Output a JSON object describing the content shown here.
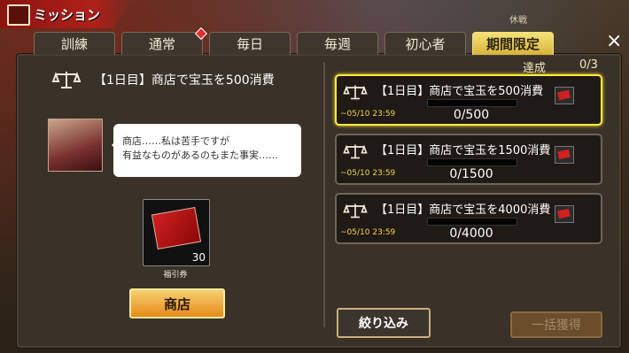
{
  "header": {
    "title": "ミッション",
    "status": "休戦"
  },
  "tabs": [
    {
      "label": "訓練",
      "active": false,
      "badge": false
    },
    {
      "label": "通常",
      "active": false,
      "badge": true
    },
    {
      "label": "毎日",
      "active": false,
      "badge": false
    },
    {
      "label": "毎週",
      "active": false,
      "badge": false
    },
    {
      "label": "初心者",
      "active": false,
      "badge": false
    },
    {
      "label": "期間限定",
      "active": true,
      "badge": false
    }
  ],
  "close_icon": "×",
  "detail": {
    "title": "【1日目】商店で宝玉を500消費",
    "dialogue_line1": "商店……私は苦手ですが",
    "dialogue_line2": "有益なものがあるのもまた事実……",
    "reward_name": "福引券",
    "reward_qty": "30",
    "shop_button": "商店"
  },
  "progress_summary": {
    "label": "達成",
    "value": "0/3"
  },
  "missions": [
    {
      "title": "【1日目】商店で宝玉を500消費",
      "deadline": "~05/10 23:59",
      "progress": "0/500",
      "progress_fraction": 0,
      "selected": true
    },
    {
      "title": "【1日目】商店で宝玉を1500消費",
      "deadline": "~05/10 23:59",
      "progress": "0/1500",
      "progress_fraction": 0,
      "selected": false
    },
    {
      "title": "【1日目】商店で宝玉を4000消費",
      "deadline": "~05/10 23:59",
      "progress": "0/4000",
      "progress_fraction": 0,
      "selected": false
    }
  ],
  "footer": {
    "filter_button": "絞り込み",
    "claim_all_button": "一括獲得"
  },
  "colors": {
    "accent_gold": "#f5e27a",
    "selected_border": "#ffe93a",
    "title_red": "#b0201a"
  }
}
